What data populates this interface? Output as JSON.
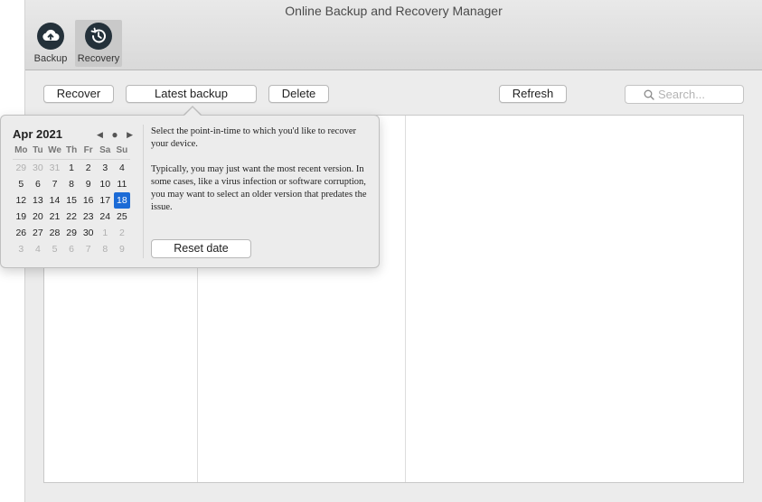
{
  "window": {
    "title": "Online Backup and Recovery Manager",
    "traffic_lights": {
      "close": "#fc5f57",
      "minimize": "#fdbc2e",
      "zoom": "#28c840"
    }
  },
  "toolbar": {
    "items": [
      {
        "label": "Backup",
        "icon": "cloud-upload-icon"
      },
      {
        "label": "Recovery",
        "icon": "history-clock-icon",
        "active": true
      }
    ]
  },
  "actions": {
    "recover": "Recover",
    "latest_backup": "Latest backup",
    "delete": "Delete",
    "refresh": "Refresh",
    "search_placeholder": "Search..."
  },
  "popover": {
    "month_label": "Apr 2021",
    "weekdays": [
      "Mo",
      "Tu",
      "We",
      "Th",
      "Fr",
      "Sa",
      "Su"
    ],
    "weeks": [
      [
        "29",
        "30",
        "31",
        "1",
        "2",
        "3",
        "4"
      ],
      [
        "5",
        "6",
        "7",
        "8",
        "9",
        "10",
        "11"
      ],
      [
        "12",
        "13",
        "14",
        "15",
        "16",
        "17",
        "18"
      ],
      [
        "19",
        "20",
        "21",
        "22",
        "23",
        "24",
        "25"
      ],
      [
        "26",
        "27",
        "28",
        "29",
        "30",
        "1",
        "2"
      ],
      [
        "3",
        "4",
        "5",
        "6",
        "7",
        "8",
        "9"
      ]
    ],
    "selected_day": "18",
    "accent_color": "#1c6bd6",
    "paragraph_1": "Select the point-in-time to which you'd like to recover your device.",
    "paragraph_2": "Typically, you may just want the most recent version. In some cases, like a virus infection or software corruption, you may want to select an older version that predates the issue.",
    "reset_label": "Reset date"
  }
}
